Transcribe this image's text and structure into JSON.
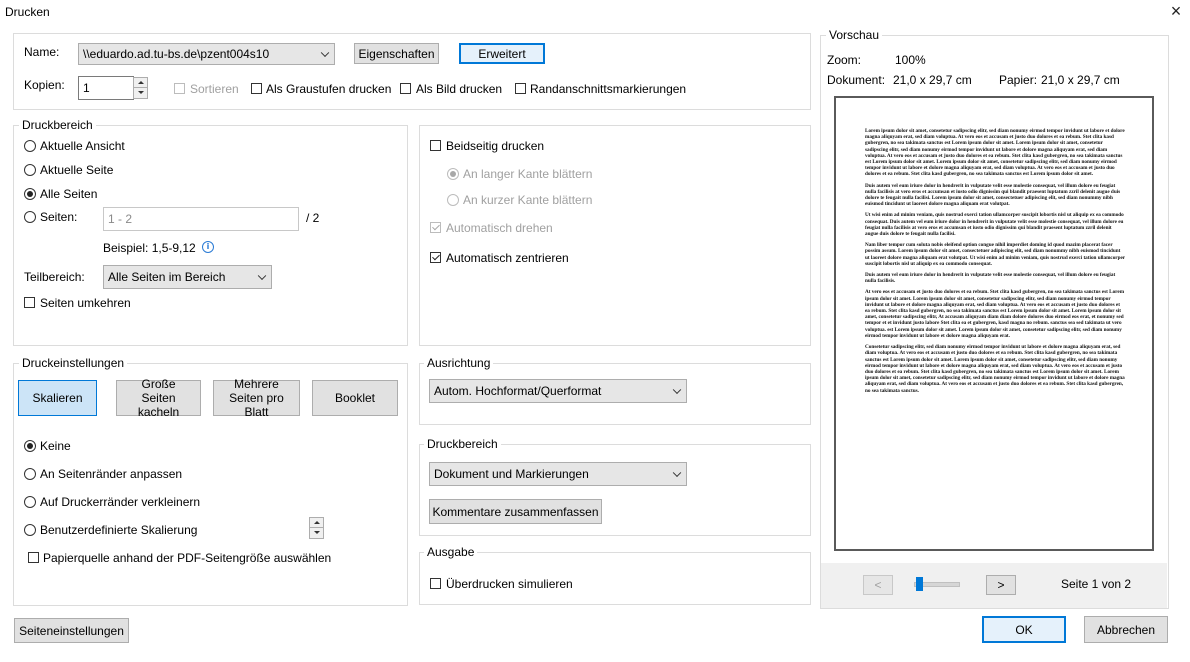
{
  "window": {
    "title": "Drucken",
    "close_label": "×"
  },
  "printer": {
    "name_label": "Name:",
    "name_value": "\\\\eduardo.ad.tu-bs.de\\pzent004s10",
    "properties_button": "Eigenschaften",
    "advanced_button": "Erweitert",
    "copies_label": "Kopien:",
    "copies_value": "1",
    "collate_label": "Sortieren",
    "grayscale_label": "Als Graustufen drucken",
    "as_image_label": "Als Bild drucken",
    "crop_marks_label": "Randanschnittsmarkierungen"
  },
  "print_range": {
    "title": "Druckbereich",
    "current_view": "Aktuelle Ansicht",
    "current_page": "Aktuelle Seite",
    "all_pages": "Alle Seiten",
    "pages_label": "Seiten:",
    "pages_placeholder": "1 - 2",
    "pages_total": "/ 2",
    "example": "Beispiel: 1,5-9,12",
    "subset_label": "Teilbereich:",
    "subset_value": "Alle Seiten im Bereich",
    "reverse_label": "Seiten umkehren"
  },
  "duplex": {
    "both_sides": "Beidseitig drucken",
    "long_edge": "An langer Kante blättern",
    "short_edge": "An kurzer Kante blättern",
    "auto_rotate": "Automatisch drehen",
    "auto_center": "Automatisch zentrieren"
  },
  "print_settings": {
    "title": "Druckeinstellungen",
    "scale_button": "Skalieren",
    "tile_button": "Große Seiten kacheln",
    "multiple_button": "Mehrere Seiten pro Blatt",
    "booklet_button": "Booklet",
    "none": "Keine",
    "fit": "An Seitenränder anpassen",
    "shrink": "Auf Druckerränder verkleinern",
    "custom": "Benutzerdefinierte Skalierung",
    "paper_source": "Papierquelle anhand der PDF-Seitengröße auswählen"
  },
  "orientation": {
    "title": "Ausrichtung",
    "value": "Autom. Hochformat/Querformat"
  },
  "output_range": {
    "title": "Druckbereich",
    "value": "Dokument und Markierungen",
    "summarize_button": "Kommentare zusammenfassen"
  },
  "output": {
    "title": "Ausgabe",
    "overprint": "Überdrucken simulieren"
  },
  "preview": {
    "title": "Vorschau",
    "zoom_label": "Zoom:",
    "zoom_value": "100%",
    "document_label": "Dokument:",
    "document_value": "21,0 x 29,7 cm",
    "paper_label": "Papier:",
    "paper_value": "21,0 x 29,7 cm",
    "prev_label": "<",
    "next_label": ">",
    "zoom_slider_fraction": 0.05,
    "page_info": "Seite 1 von 2",
    "paragraphs": [
      "Lorem ipsum dolor sit amet, consetetur sadipscing elitr, sed diam nonumy eirmod tempor invidunt ut labore et dolore magna aliquyam erat, sed diam voluptua. At vero eos et accusam et justo duo dolores et ea rebum. Stet clita kasd gubergren, no sea takimata sanctus est Lorem ipsum dolor sit amet. Lorem ipsum dolor sit amet, consetetur sadipscing elitr, sed diam nonumy eirmod tempor invidunt ut labore et dolore magna aliquyam erat, sed diam voluptua. At vero eos et accusam et justo duo dolores et ea rebum. Stet clita kasd gubergren, no sea takimata sanctus est Lorem ipsum dolor sit amet. Lorem ipsum dolor sit amet, consetetur sadipscing elitr, sed diam nonumy eirmod tempor invidunt ut labore et dolore magna aliquyam erat, sed diam voluptua. At vero eos et accusam et justo duo dolores et ea rebum. Stet clita kasd gubergren, no sea takimata sanctus est Lorem ipsum dolor sit amet.",
      "Duis autem vel eum iriure dolor in hendrerit in vulputate velit esse molestie consequat, vel illum dolore eu feugiat nulla facilisis at vero eros et accumsan et iusto odio dignissim qui blandit praesent luptatum zzril delenit augue duis dolore te feugait nulla facilisi. Lorem ipsum dolor sit amet, consectetuer adipiscing elit, sed diam nonummy nibh euismod tincidunt ut laoreet dolore magna aliquam erat volutpat.",
      "Ut wisi enim ad minim veniam, quis nostrud exerci tation ullamcorper suscipit lobortis nisl ut aliquip ex ea commodo consequat. Duis autem vel eum iriure dolor in hendrerit in vulputate velit esse molestie consequat, vel illum dolore eu feugiat nulla facilisis at vero eros et accumsan et iusto odio dignissim qui blandit praesent luptatum zzril delenit augue duis dolore te feugait nulla facilisi.",
      "Nam liber tempor cum soluta nobis eleifend option congue nihil imperdiet doming id quod mazim placerat facer possim assum. Lorem ipsum dolor sit amet, consectetuer adipiscing elit, sed diam nonummy nibh euismod tincidunt ut laoreet dolore magna aliquam erat volutpat. Ut wisi enim ad minim veniam, quis nostrud exerci tation ullamcorper suscipit lobortis nisl ut aliquip ex ea commodo consequat.",
      "Duis autem vel eum iriure dolor in hendrerit in vulputate velit esse molestie consequat, vel illum dolore eu feugiat nulla facilisis.",
      "At vero eos et accusam et justo duo dolores et ea rebum. Stet clita kasd gubergren, no sea takimata sanctus est Lorem ipsum dolor sit amet. Lorem ipsum dolor sit amet, consetetur sadipscing elitr, sed diam nonumy eirmod tempor invidunt ut labore et dolore magna aliquyam erat, sed diam voluptua. At vero eos et accusam et justo duo dolores et ea rebum. Stet clita kasd gubergren, no sea takimata sanctus est Lorem ipsum dolor sit amet. Lorem ipsum dolor sit amet, consetetur sadipscing elitr, At accusam aliquyam diam diam dolore dolores duo eirmod eos erat, et nonumy sed tempor et et invidunt justo labore Stet clita ea et gubergren, kasd magna no rebum. sanctus sea sed takimata ut vero voluptua. est Lorem ipsum dolor sit amet. Lorem ipsum dolor sit amet, consetetur sadipscing elitr, sed diam nonumy eirmod tempor invidunt ut labore et dolore magna aliquyam erat.",
      "Consetetur sadipscing elitr, sed diam nonumy eirmod tempor invidunt ut labore et dolore magna aliquyam erat, sed diam voluptua. At vero eos et accusam et justo duo dolores et ea rebum. Stet clita kasd gubergren, no sea takimata sanctus est Lorem ipsum dolor sit amet. Lorem ipsum dolor sit amet, consetetur sadipscing elitr, sed diam nonumy eirmod tempor invidunt ut labore et dolore magna aliquyam erat, sed diam voluptua. At vero eos et accusam et justo duo dolores et ea rebum. Stet clita kasd gubergren, no sea takimata sanctus est Lorem ipsum dolor sit amet. Lorem ipsum dolor sit amet, consetetur sadipscing elitr, sed diam nonumy eirmod tempor invidunt ut labore et dolore magna aliquyam erat, sed diam voluptua. At vero eos et accusam et justo duo dolores et ea rebum. Stet clita kasd gubergren, no sea takimata sanctus."
    ]
  },
  "footer": {
    "page_setup_button": "Seiteneinstellungen",
    "ok_button": "OK",
    "cancel_button": "Abbrechen"
  },
  "colors": {
    "accent": "#0078d7",
    "selected_background": "#cce4f7",
    "button_background": "#e1e1e1"
  }
}
